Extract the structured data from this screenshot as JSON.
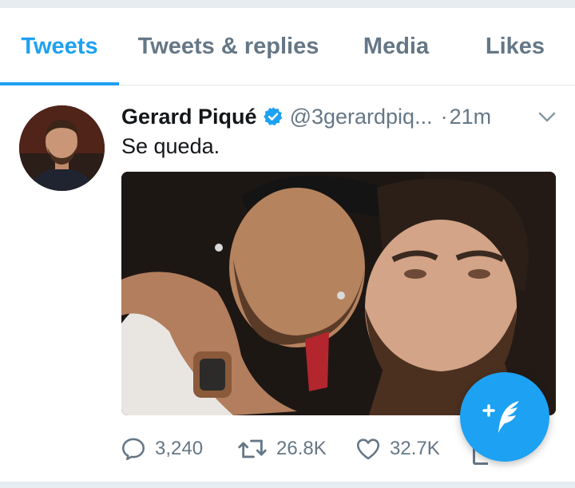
{
  "tabs": [
    {
      "label": "Tweets",
      "active": true
    },
    {
      "label": "Tweets & replies",
      "active": false
    },
    {
      "label": "Media",
      "active": false
    },
    {
      "label": "Likes",
      "active": false
    }
  ],
  "tweet": {
    "author_name": "Gerard Piqué",
    "handle": "@3gerardpiq...",
    "separator": "·",
    "time": "21m",
    "text": "Se queda.",
    "replies": "3,240",
    "retweets": "26.8K",
    "likes": "32.7K"
  },
  "icons": {
    "verified": "verified-badge-icon",
    "caret": "chevron-down-icon",
    "reply": "reply-icon",
    "retweet": "retweet-icon",
    "like": "heart-icon",
    "share": "share-icon",
    "compose": "compose-tweet-icon"
  },
  "colors": {
    "accent": "#1da1f2",
    "text_primary": "#14171a",
    "text_secondary": "#657786",
    "divider": "#e1e8ed"
  }
}
